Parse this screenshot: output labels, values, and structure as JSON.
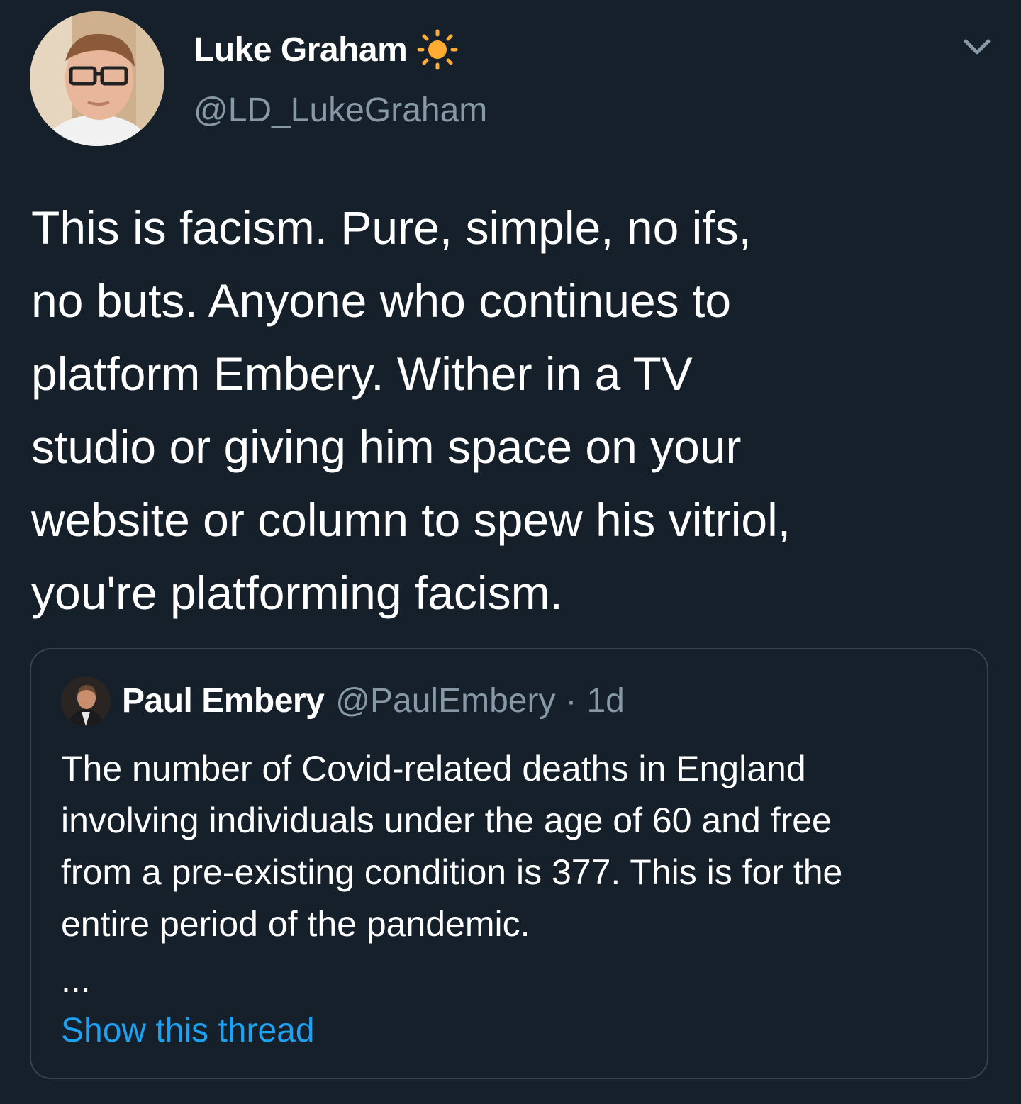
{
  "author": {
    "display_name": "Luke Graham",
    "handle": "@LD_LukeGraham",
    "name_emoji": "sun-icon",
    "avatar": "avatar-photo"
  },
  "tweet": {
    "text": "This is facism. Pure, simple, no ifs,\nno buts. Anyone who continues to\nplatform Embery. Wither in a TV\nstudio or giving him space on your\nwebsite or column to spew his vitriol,\nyou're platforming facism."
  },
  "menu_icon": "chevron-down-icon",
  "quoted_tweet": {
    "display_name": "Paul Embery",
    "handle": "@PaulEmbery",
    "separator": "·",
    "time": "1d",
    "text": "The number of Covid-related deaths in England\ninvolving individuals under the age of 60 and free\nfrom a pre-existing condition is 377. This is for the\nentire period of the pandemic.",
    "ellipsis": "...",
    "show_thread_label": "Show this thread"
  },
  "colors": {
    "background": "#15202b",
    "text_primary": "#ffffff",
    "text_secondary": "#8899a6",
    "link": "#1da1f2",
    "border": "#38444d",
    "sun": "#ffac33"
  }
}
